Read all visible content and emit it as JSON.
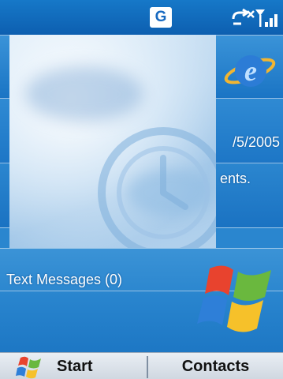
{
  "statusbar": {
    "network_badge": "G",
    "icons": [
      "connectivity-icon",
      "signal-strength-icon"
    ]
  },
  "today": {
    "date_text": "/5/2005",
    "appointments_text": "ents.",
    "messages_text": "Text Messages (0)"
  },
  "softkeys": {
    "left_label": "Start",
    "right_label": "Contacts"
  },
  "colors": {
    "background_blue": "#1670c0",
    "softbar": "#cfd7e0",
    "text": "#ffffff"
  }
}
